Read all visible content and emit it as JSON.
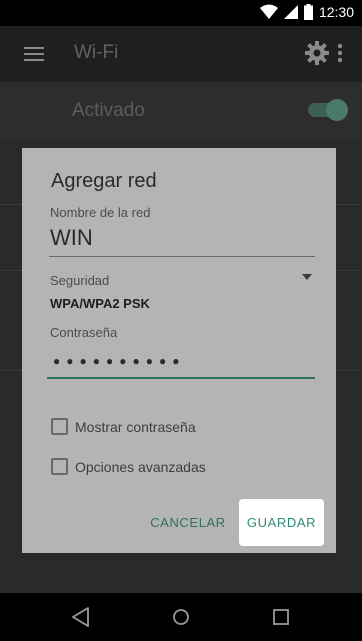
{
  "status_bar": {
    "time": "12:30",
    "icons": [
      "wifi-icon",
      "cellular-signal-icon",
      "battery-icon"
    ]
  },
  "app_bar": {
    "title": "Wi-Fi",
    "icons": [
      "menu-icon",
      "gear-icon",
      "overflow-menu-icon"
    ]
  },
  "wifi_switch": {
    "label": "Activado",
    "state": "on"
  },
  "dialog": {
    "title": "Agregar red",
    "network_name": {
      "label": "Nombre de la red",
      "value": "WIN"
    },
    "security": {
      "label": "Seguridad",
      "value": "WPA/WPA2 PSK"
    },
    "password": {
      "label": "Contraseña",
      "value": "●●●●●●●●●●"
    },
    "checkboxes": [
      {
        "label": "Mostrar contraseña",
        "checked": false
      },
      {
        "label": "Opciones avanzadas",
        "checked": false
      }
    ],
    "buttons": {
      "cancel": "CANCELAR",
      "save": "GUARDAR"
    }
  },
  "nav_bar": {
    "icons": [
      "back-icon",
      "home-icon",
      "recents-icon"
    ]
  },
  "colors": {
    "accent": "#2f6e62",
    "dialog_background": "#b4b4b4"
  }
}
